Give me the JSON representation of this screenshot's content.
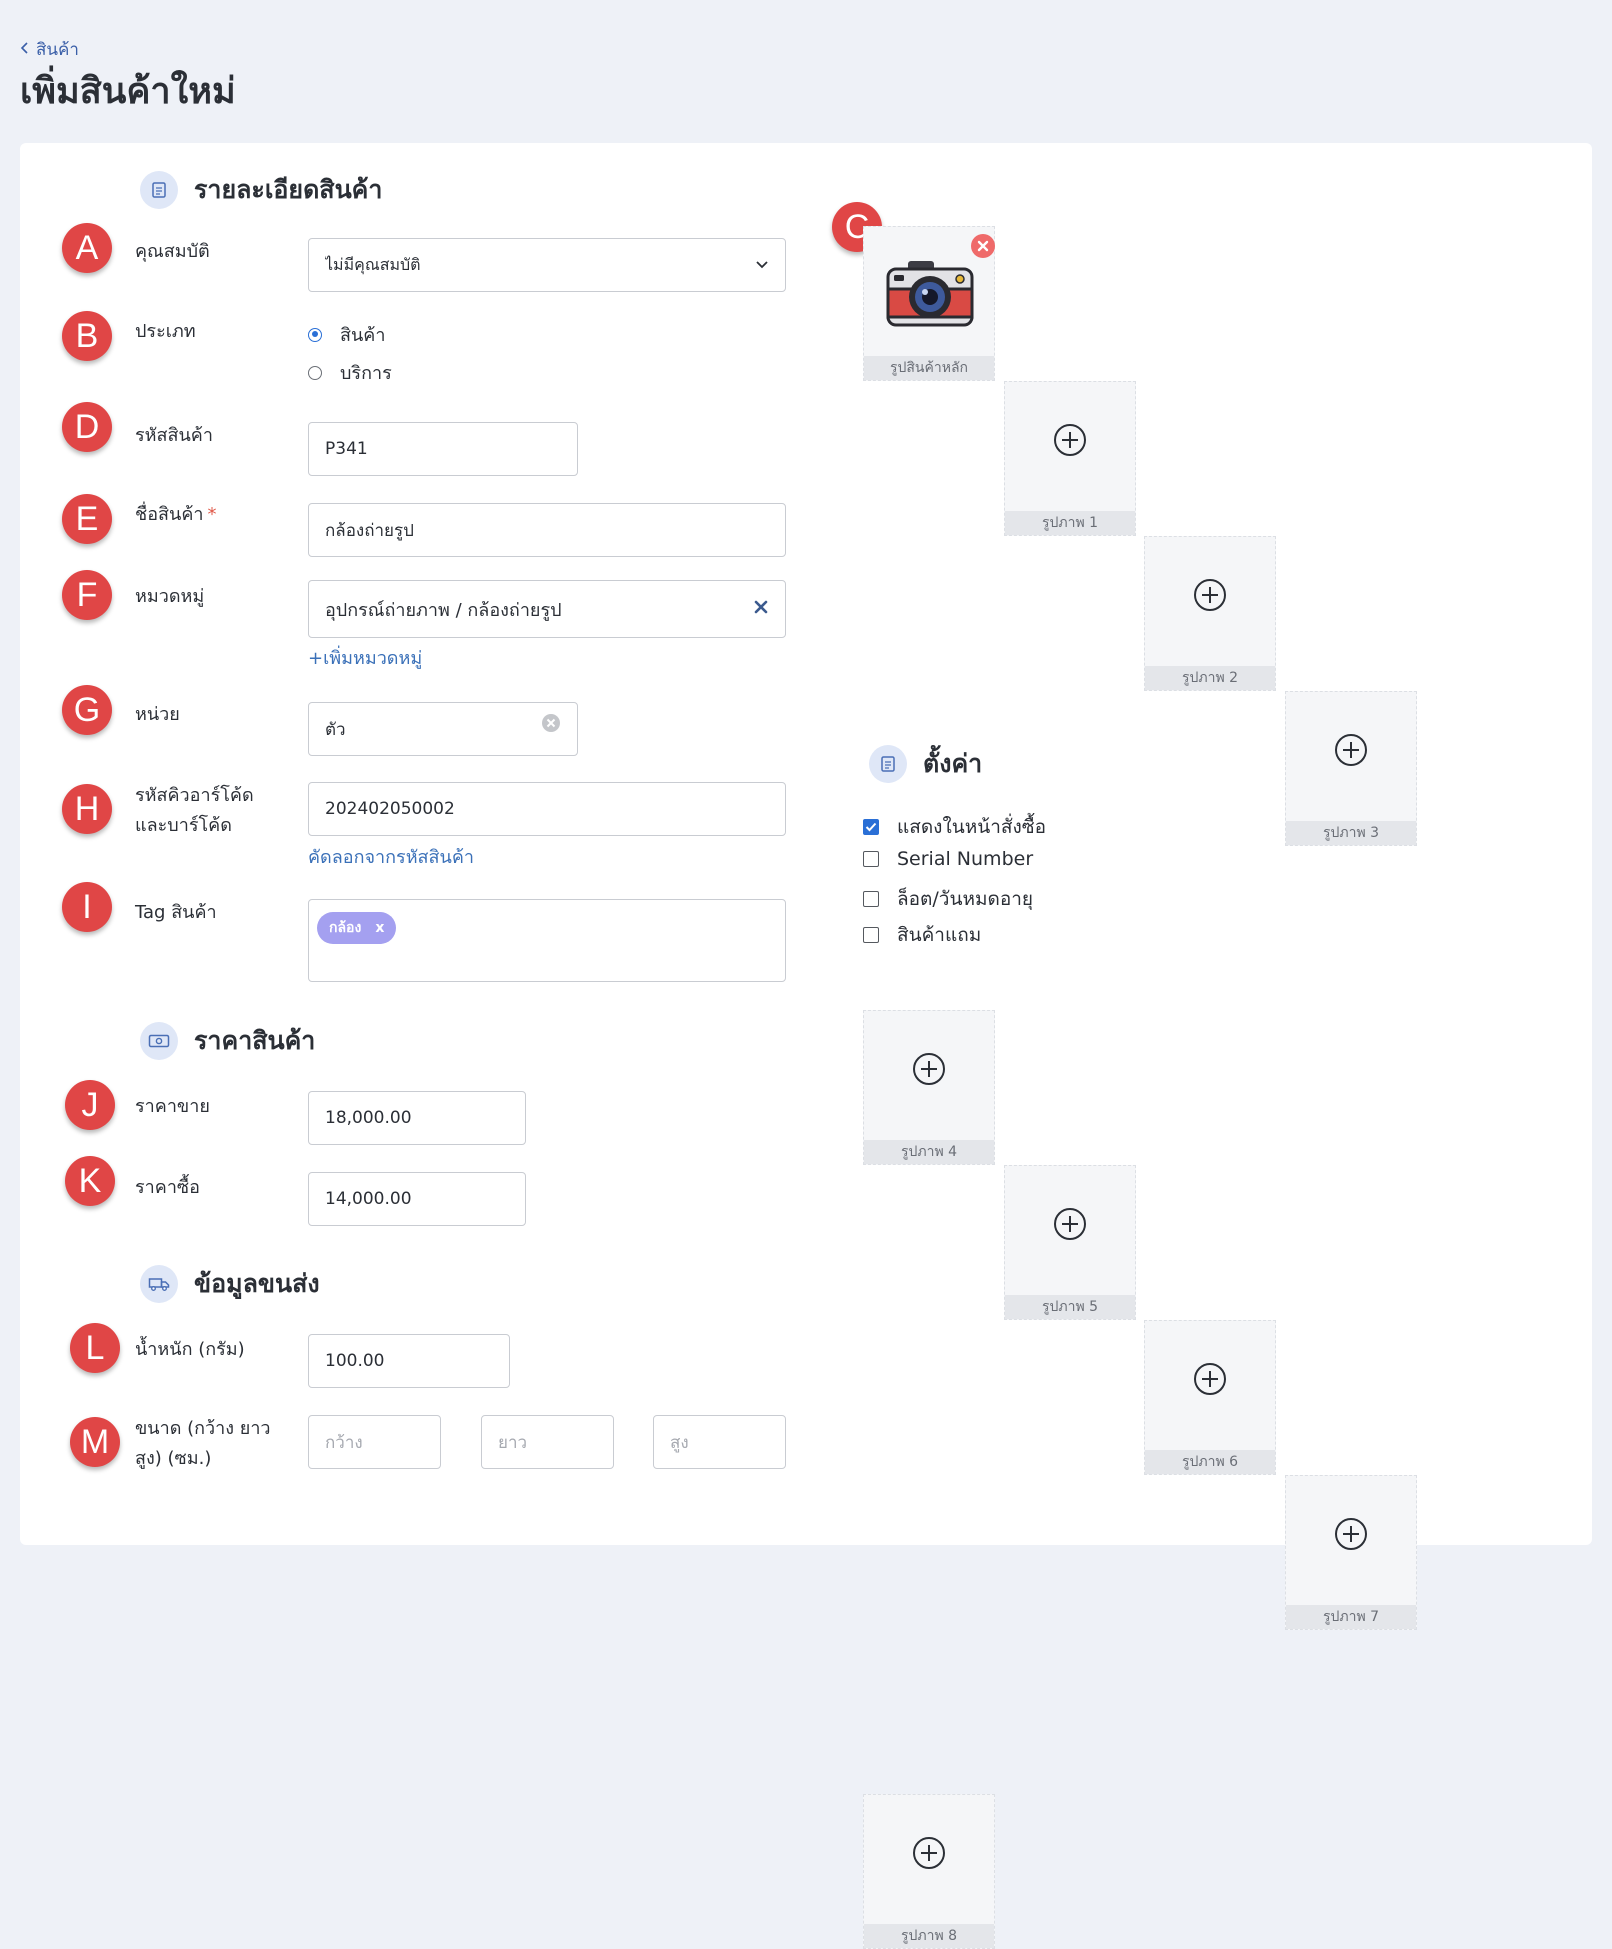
{
  "breadcrumb": {
    "label": "สินค้า"
  },
  "page": {
    "title": "เพิ่มสินค้าใหม่"
  },
  "sections": {
    "details": "รายละเอียดสินค้า",
    "price": "ราคาสินค้า",
    "shipping": "ข้อมูลขนส่ง",
    "settings": "ตั้งค่า"
  },
  "markers": {
    "A": "A",
    "B": "B",
    "C": "C",
    "D": "D",
    "E": "E",
    "F": "F",
    "G": "G",
    "H": "H",
    "I": "I",
    "J": "J",
    "K": "K",
    "L": "L",
    "M": "M"
  },
  "form": {
    "attribute": {
      "label": "คุณสมบัติ",
      "value": "ไม่มีคุณสมบัติ"
    },
    "type": {
      "label": "ประเภท",
      "options": [
        "สินค้า",
        "บริการ"
      ],
      "selected": "สินค้า"
    },
    "code": {
      "label": "รหัสสินค้า",
      "value": "P341"
    },
    "name": {
      "label": "ชื่อสินค้า",
      "required_mark": "*",
      "value": "กล้องถ่ายรูป"
    },
    "category": {
      "label": "หมวดหมู่",
      "value": "อุปกรณ์ถ่ายภาพ / กล้องถ่ายรูป",
      "add_link": "+เพิ่มหมวดหมู่"
    },
    "unit": {
      "label": "หน่วย",
      "value": "ตัว"
    },
    "barcode": {
      "label_line1": "รหัสคิวอาร์โค้ด",
      "label_line2": "และบาร์โค้ด",
      "value": "202402050002",
      "copy_link": "คัดลอกจากรหัสสินค้า"
    },
    "tags": {
      "label": "Tag สินค้า",
      "items": [
        {
          "text": "กล้อง",
          "remove": "x"
        }
      ]
    }
  },
  "price": {
    "sell": {
      "label": "ราคาขาย",
      "value": "18,000.00"
    },
    "buy": {
      "label": "ราคาซื้อ",
      "value": "14,000.00"
    }
  },
  "shipping": {
    "weight": {
      "label": "น้ำหนัก (กรัม)",
      "value": "100.00"
    },
    "size": {
      "label_line1": "ขนาด (กว้าง ยาว",
      "label_line2": "สูง) (ซม.)",
      "width_placeholder": "กว้าง",
      "length_placeholder": "ยาว",
      "height_placeholder": "สูง"
    }
  },
  "images": {
    "main_label": "รูปสินค้าหลัก",
    "slots": [
      "รูปภาพ 1",
      "รูปภาพ 2",
      "รูปภาพ 3",
      "รูปภาพ 4",
      "รูปภาพ 5",
      "รูปภาพ 6",
      "รูปภาพ 7",
      "รูปภาพ 8"
    ]
  },
  "settings": {
    "options": [
      {
        "label": "แสดงในหน้าสั่งซื้อ",
        "checked": true
      },
      {
        "label": "Serial Number",
        "checked": false
      },
      {
        "label": "ล็อต/วันหมดอายุ",
        "checked": false
      },
      {
        "label": "สินค้าแถม",
        "checked": false
      }
    ]
  },
  "colors": {
    "accent": "#2a6fd6",
    "marker": "#e04646",
    "tag": "#a4a0f0",
    "link": "#3a70b8"
  }
}
